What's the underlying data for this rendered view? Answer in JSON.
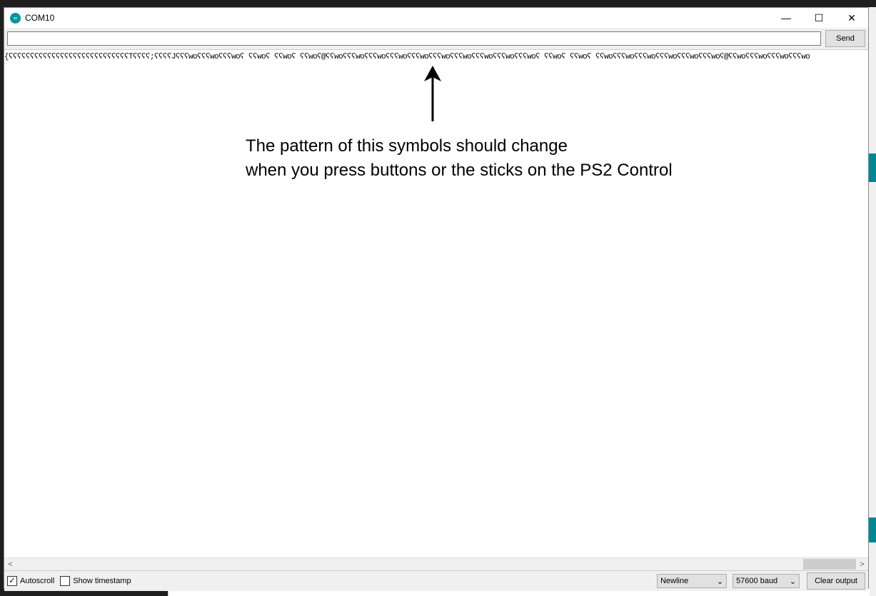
{
  "window": {
    "title": "COM10",
    "minimize_icon": "minimize-icon",
    "maximize_icon": "maximize-icon",
    "close_icon": "close-icon"
  },
  "send_bar": {
    "input_value": "",
    "send_label": "Send"
  },
  "output": {
    "text": "{ʕʕʕʕʕʕʕʕʕʕʕʕʕʕʕʕʕʕʕʕʕʕʕʕʕʕʕʕTʕʕʕʕ;ʕʕʕʕJʕʕʕwoʕʕʕwoʕʕʕwoʕ ʕʕwoʕ ʕʕwoʕ ʕʕwoʕ@ʕʕwoʕʕʕwoʕʕʕwoʕʕʕwoʕʕʕwoʕʕʕwoʕʕʕwoʕʕʕwoʕʕʕwoʕʕʕwoʕ ʕʕwoʕ ʕʕwoʕ ʕʕwoʕʕʕwoʕʕʕwoʕʕʕwoʕʕʕwoʕʕʕwoʕ@ʕʕwoʕʕʕwoʕʕʕwoʕʕʕwo",
    "annotation_line1": "The pattern of this symbols should change",
    "annotation_line2": "when you press buttons or the sticks on the PS2 Control"
  },
  "status_bar": {
    "autoscroll_label": "Autoscroll",
    "autoscroll_checked": true,
    "timestamp_label": "Show timestamp",
    "timestamp_checked": false,
    "line_ending": "Newline",
    "baud_rate": "57600 baud",
    "clear_label": "Clear output"
  }
}
